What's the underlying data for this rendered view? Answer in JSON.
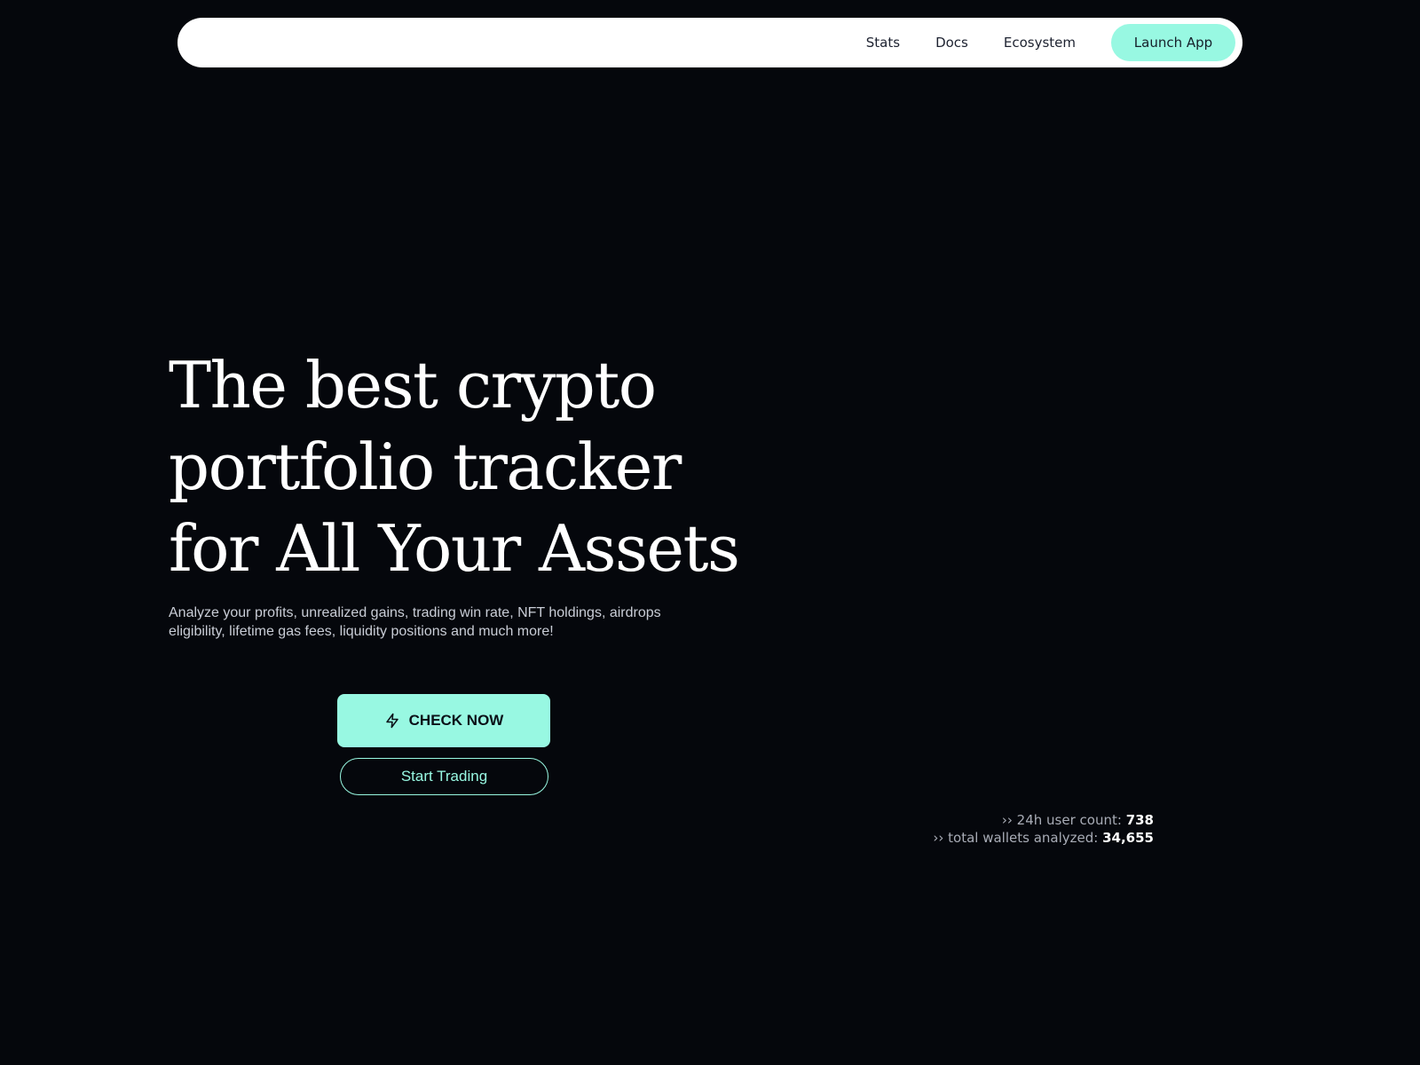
{
  "nav": {
    "links": [
      "Stats",
      "Docs",
      "Ecosystem"
    ],
    "launch_label": "Launch App"
  },
  "hero": {
    "title_lines": [
      "The best crypto",
      "portfolio tracker",
      "for All Your Assets"
    ],
    "subtitle": "Analyze your profits, unrealized gains, trading win rate, NFT holdings, airdrops eligibility, lifetime gas fees, liquidity positions and much more!"
  },
  "cta": {
    "primary_label": "CHECK NOW",
    "primary_icon": "lightning-bolt-icon",
    "secondary_label": "Start Trading"
  },
  "stats": {
    "user_count_label": "›› 24h user count:",
    "user_count_value": "738",
    "wallets_label": "›› total wallets analyzed:",
    "wallets_value": "34,655"
  },
  "colors": {
    "background": "#05070c",
    "accent": "#98f8e2",
    "nav_bg": "#ffffff"
  }
}
